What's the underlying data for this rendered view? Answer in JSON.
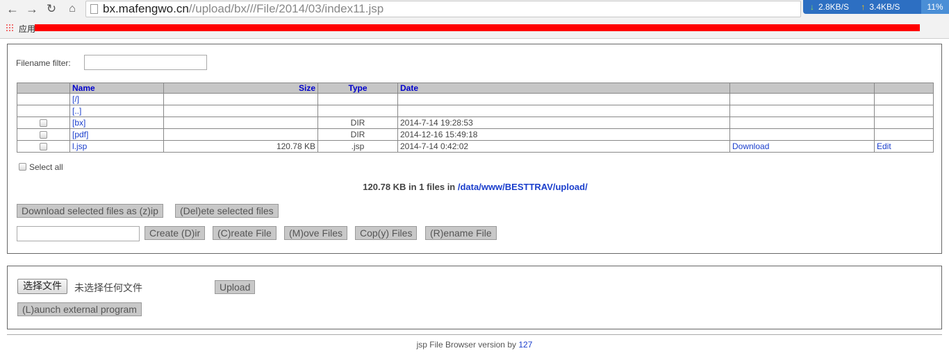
{
  "browser": {
    "url_host": "bx.mafengwo.cn",
    "url_path": "//upload/bx///File/2014/03/index11.jsp",
    "download_speed": "2.8KB/S",
    "upload_speed": "3.4KB/S",
    "cpu_percent": "11%",
    "apps_label": "应用"
  },
  "filter": {
    "label": "Filename filter:",
    "value": ""
  },
  "table": {
    "headers": {
      "name": "Name",
      "size": "Size",
      "type": "Type",
      "date": "Date"
    },
    "nav_rows": [
      {
        "name": "[/]"
      },
      {
        "name": "[..]"
      }
    ],
    "rows": [
      {
        "name": "[bx]",
        "size": "",
        "type": "DIR",
        "date": "2014-7-14 19:28:53",
        "download": "",
        "edit": ""
      },
      {
        "name": "[pdf]",
        "size": "",
        "type": "DIR",
        "date": "2014-12-16 15:49:18",
        "download": "",
        "edit": ""
      },
      {
        "name": "l.jsp",
        "size": "120.78 KB",
        "type": ".jsp",
        "date": "2014-7-14 0:42:02",
        "download": "Download",
        "edit": "Edit"
      }
    ]
  },
  "select_all_label": "Select all",
  "summary": {
    "text": "120.78 KB in 1 files in",
    "path": "/data/www/BESTTRAV/upload/"
  },
  "actions": {
    "download_zip": "Download selected files as (z)ip",
    "delete": "(Del)ete selected files",
    "new_name_value": "",
    "create_dir": "Create (D)ir",
    "create_file": "(C)reate File",
    "move": "(M)ove Files",
    "copy": "Cop(y) Files",
    "rename": "(R)ename File"
  },
  "upload": {
    "choose_file": "选择文件",
    "no_file": "未选择任何文件",
    "upload": "Upload",
    "launch": "(L)aunch external program"
  },
  "footer": {
    "text": "jsp File Browser version by",
    "author": "127"
  }
}
